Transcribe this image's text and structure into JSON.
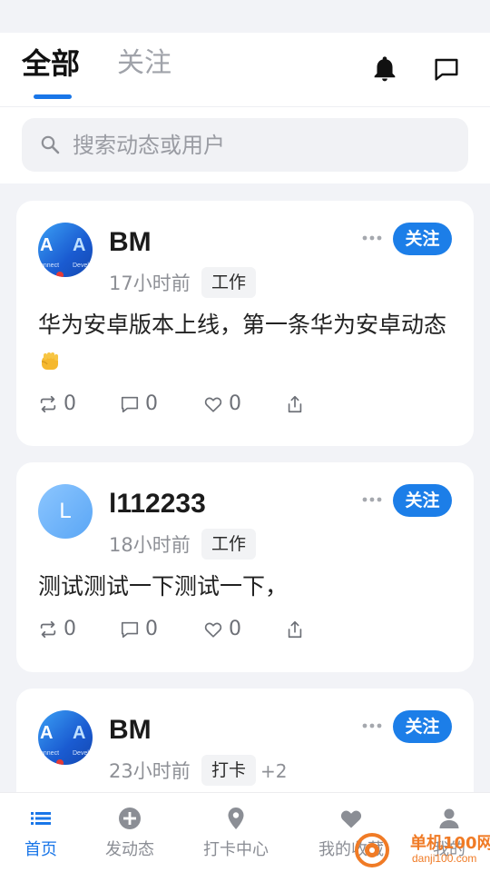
{
  "header": {
    "tabs": [
      {
        "label": "全部",
        "active": true
      },
      {
        "label": "关注",
        "active": false
      }
    ],
    "icons": [
      "bell-icon",
      "chat-bubble-icon"
    ]
  },
  "search": {
    "placeholder": "搜索动态或用户"
  },
  "posts": [
    {
      "username": "BM",
      "avatar": "app-store-icon",
      "time": "17小时前",
      "tags": [
        "工作"
      ],
      "extra_tags": "",
      "follow_label": "关注",
      "content": "华为安卓版本上线，第一条华为安卓动态",
      "emoji": "fist-emoji",
      "reposts": "0",
      "comments": "0",
      "likes": "0"
    },
    {
      "username": "l112233",
      "avatar_letter": "L",
      "time": "18小时前",
      "tags": [
        "工作"
      ],
      "extra_tags": "",
      "follow_label": "关注",
      "content": "测试测试一下测试一下，",
      "reposts": "0",
      "comments": "0",
      "likes": "0"
    },
    {
      "username": "BM",
      "avatar": "app-store-icon",
      "time": "23小时前",
      "tags": [
        "打卡"
      ],
      "extra_tags": "+2",
      "follow_label": "关注"
    }
  ],
  "tabbar": {
    "items": [
      {
        "label": "首页",
        "icon": "list-icon",
        "active": true
      },
      {
        "label": "发动态",
        "icon": "plus-circle-icon",
        "active": false
      },
      {
        "label": "打卡中心",
        "icon": "location-pin-icon",
        "active": false
      },
      {
        "label": "我的收藏",
        "icon": "heart-icon",
        "active": false
      },
      {
        "label": "我的",
        "icon": "person-icon",
        "active": false
      }
    ]
  },
  "watermark": {
    "title": "单机100网",
    "subtitle": "danji100.com"
  },
  "colors": {
    "accent": "#1976e8",
    "follow_button": "#1c7ee8",
    "page_bg": "#f2f3f7",
    "watermark": "#f07b26"
  }
}
